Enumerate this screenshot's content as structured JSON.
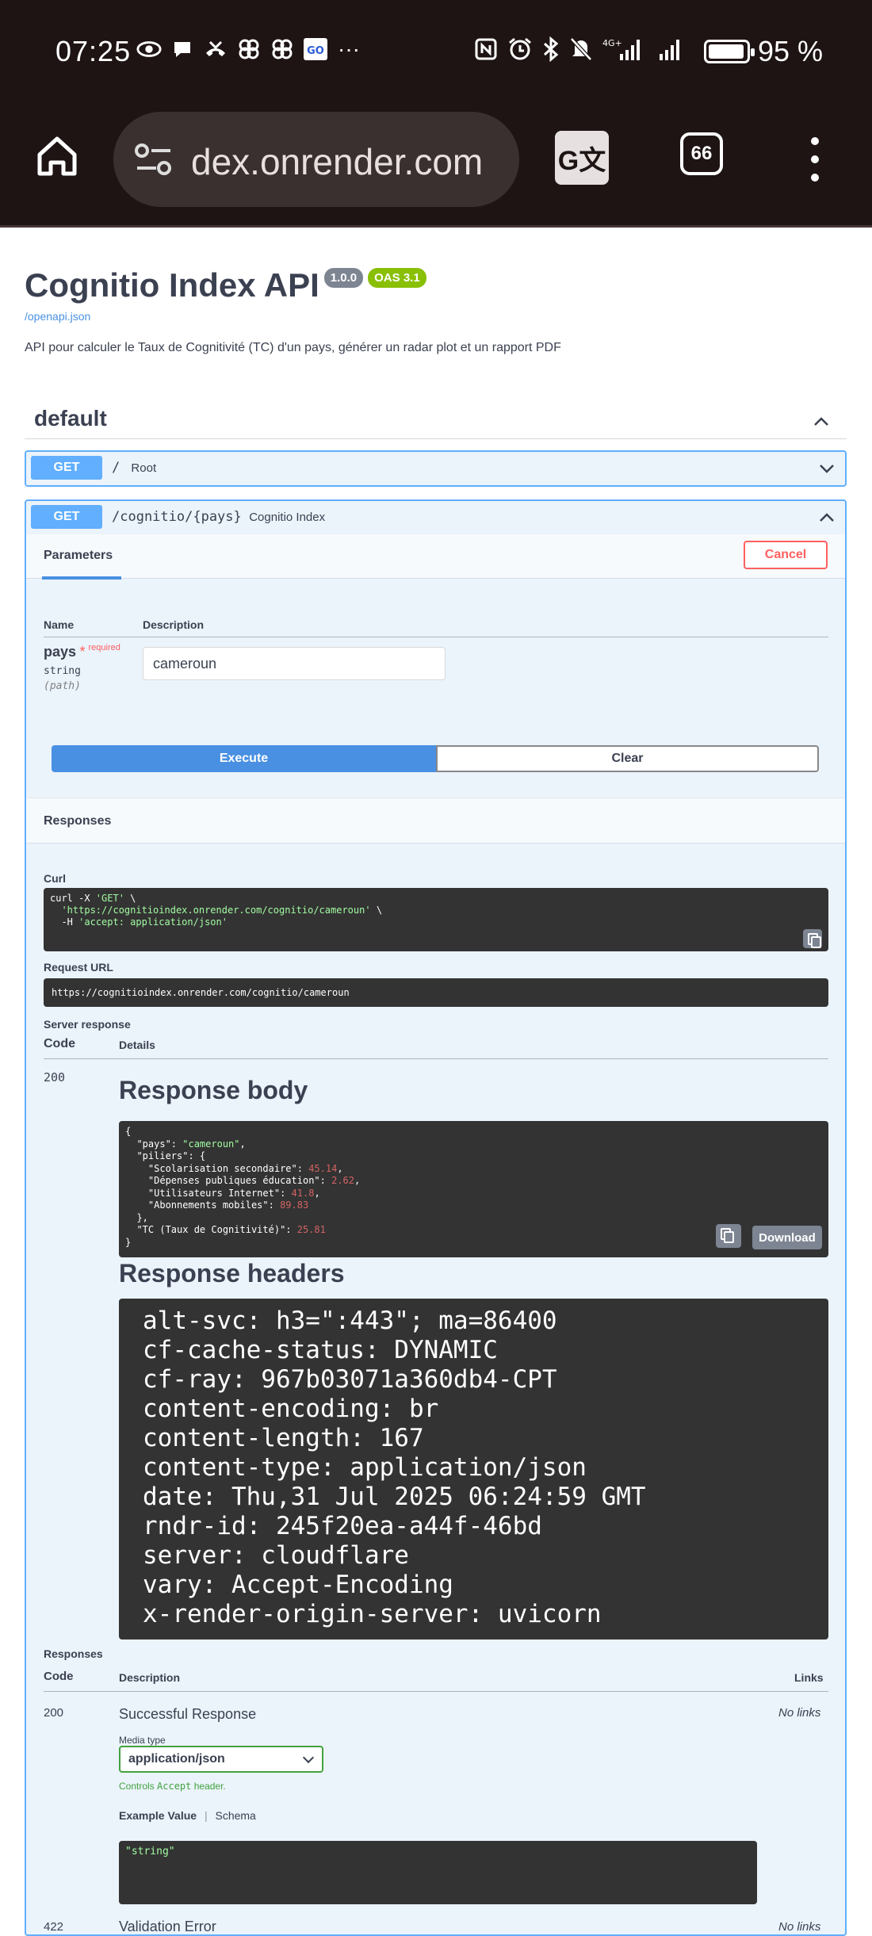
{
  "status_bar": {
    "time": "07:25",
    "overflow": "···",
    "battery_percent": 95,
    "battery_text": "95 %",
    "network": "4G+"
  },
  "browser": {
    "url": "dex.onrender.com",
    "tab_count": "66"
  },
  "api": {
    "title": "Cognitio Index API",
    "version_badge": "1.0.0",
    "oas_badge": "OAS 3.1",
    "spec_link": "/openapi.json",
    "description": "API pour calculer le Taux de Cognitivité (TC) d'un pays, générer un radar plot et un rapport PDF"
  },
  "tag": {
    "name": "default"
  },
  "endpoints": [
    {
      "method": "GET",
      "path": "/",
      "summary": "Root"
    },
    {
      "method": "GET",
      "path": "/cognitio/{pays}",
      "summary": "Cognitio Index"
    }
  ],
  "try_it": {
    "tab_label": "Parameters",
    "cancel_label": "Cancel",
    "col_name": "Name",
    "col_description": "Description",
    "param": {
      "name": "pays",
      "required_star": "*",
      "required_label": "required",
      "type": "string",
      "location": "(path)",
      "value": "cameroun"
    },
    "execute_label": "Execute",
    "clear_label": "Clear",
    "responses_label": "Responses"
  },
  "result": {
    "curl_label": "Curl",
    "curl_line1_prefix": "curl -X ",
    "curl_line1_method": "'GET'",
    "curl_line1_suffix": " \\",
    "curl_line2_url": "'https://cognitioindex.onrender.com/cognitio/cameroun'",
    "curl_line2_suffix": " \\",
    "curl_line3_prefix": "-H ",
    "curl_line3_header": "'accept: application/json'",
    "request_url_label": "Request URL",
    "request_url": "https://cognitioindex.onrender.com/cognitio/cameroun",
    "server_response_label": "Server response",
    "col_code": "Code",
    "col_details": "Details",
    "code": "200",
    "response_body_title": "Response body",
    "body": {
      "pays_key": "\"pays\": ",
      "pays_val": "\"cameroun\"",
      "piliers_key": "\"piliers\": {",
      "items": [
        {
          "key": "\"Scolarisation secondaire\": ",
          "val": "45.14"
        },
        {
          "key": "\"Dépenses publiques éducation\": ",
          "val": "2.62"
        },
        {
          "key": "\"Utilisateurs Internet\": ",
          "val": "41.8"
        },
        {
          "key": "\"Abonnements mobiles\": ",
          "val": "89.83"
        }
      ],
      "tc_key": "\"TC (Taux de Cognitivité)\": ",
      "tc_val": "25.81"
    },
    "download_label": "Download",
    "response_headers_title": "Response headers",
    "headers": [
      "alt-svc: h3=\":443\"; ma=86400",
      "cf-cache-status: DYNAMIC",
      "cf-ray: 967b03071a360db4-CPT",
      "content-encoding: br",
      "content-length: 167",
      "content-type: application/json",
      "date: Thu,31 Jul 2025 06:24:59 GMT",
      "rndr-id: 245f20ea-a44f-46bd",
      "server: cloudflare",
      "vary: Accept-Encoding",
      "x-render-origin-server: uvicorn"
    ]
  },
  "responses": {
    "label": "Responses",
    "col_code": "Code",
    "col_description": "Description",
    "col_links": "Links",
    "ok_code": "200",
    "ok_desc": "Successful Response",
    "ok_links": "No links",
    "media_type_label": "Media type",
    "media_type_value": "application/json",
    "controls_prefix": "Controls ",
    "controls_code": "Accept",
    "controls_suffix": " header.",
    "example_value_tab": "Example Value",
    "schema_tab": "Schema",
    "example": "\"string\"",
    "err_code": "422",
    "err_desc": "Validation Error",
    "err_links": "No links"
  },
  "colors": {
    "get_blue": "#61affe",
    "execute_blue": "#4990e2",
    "cancel_red": "#ff6060",
    "oas_green": "#89bf04",
    "version_gray": "#7d8492",
    "code_bg": "#333333",
    "string_green": "#a2fca2",
    "number_red": "#d36363"
  }
}
